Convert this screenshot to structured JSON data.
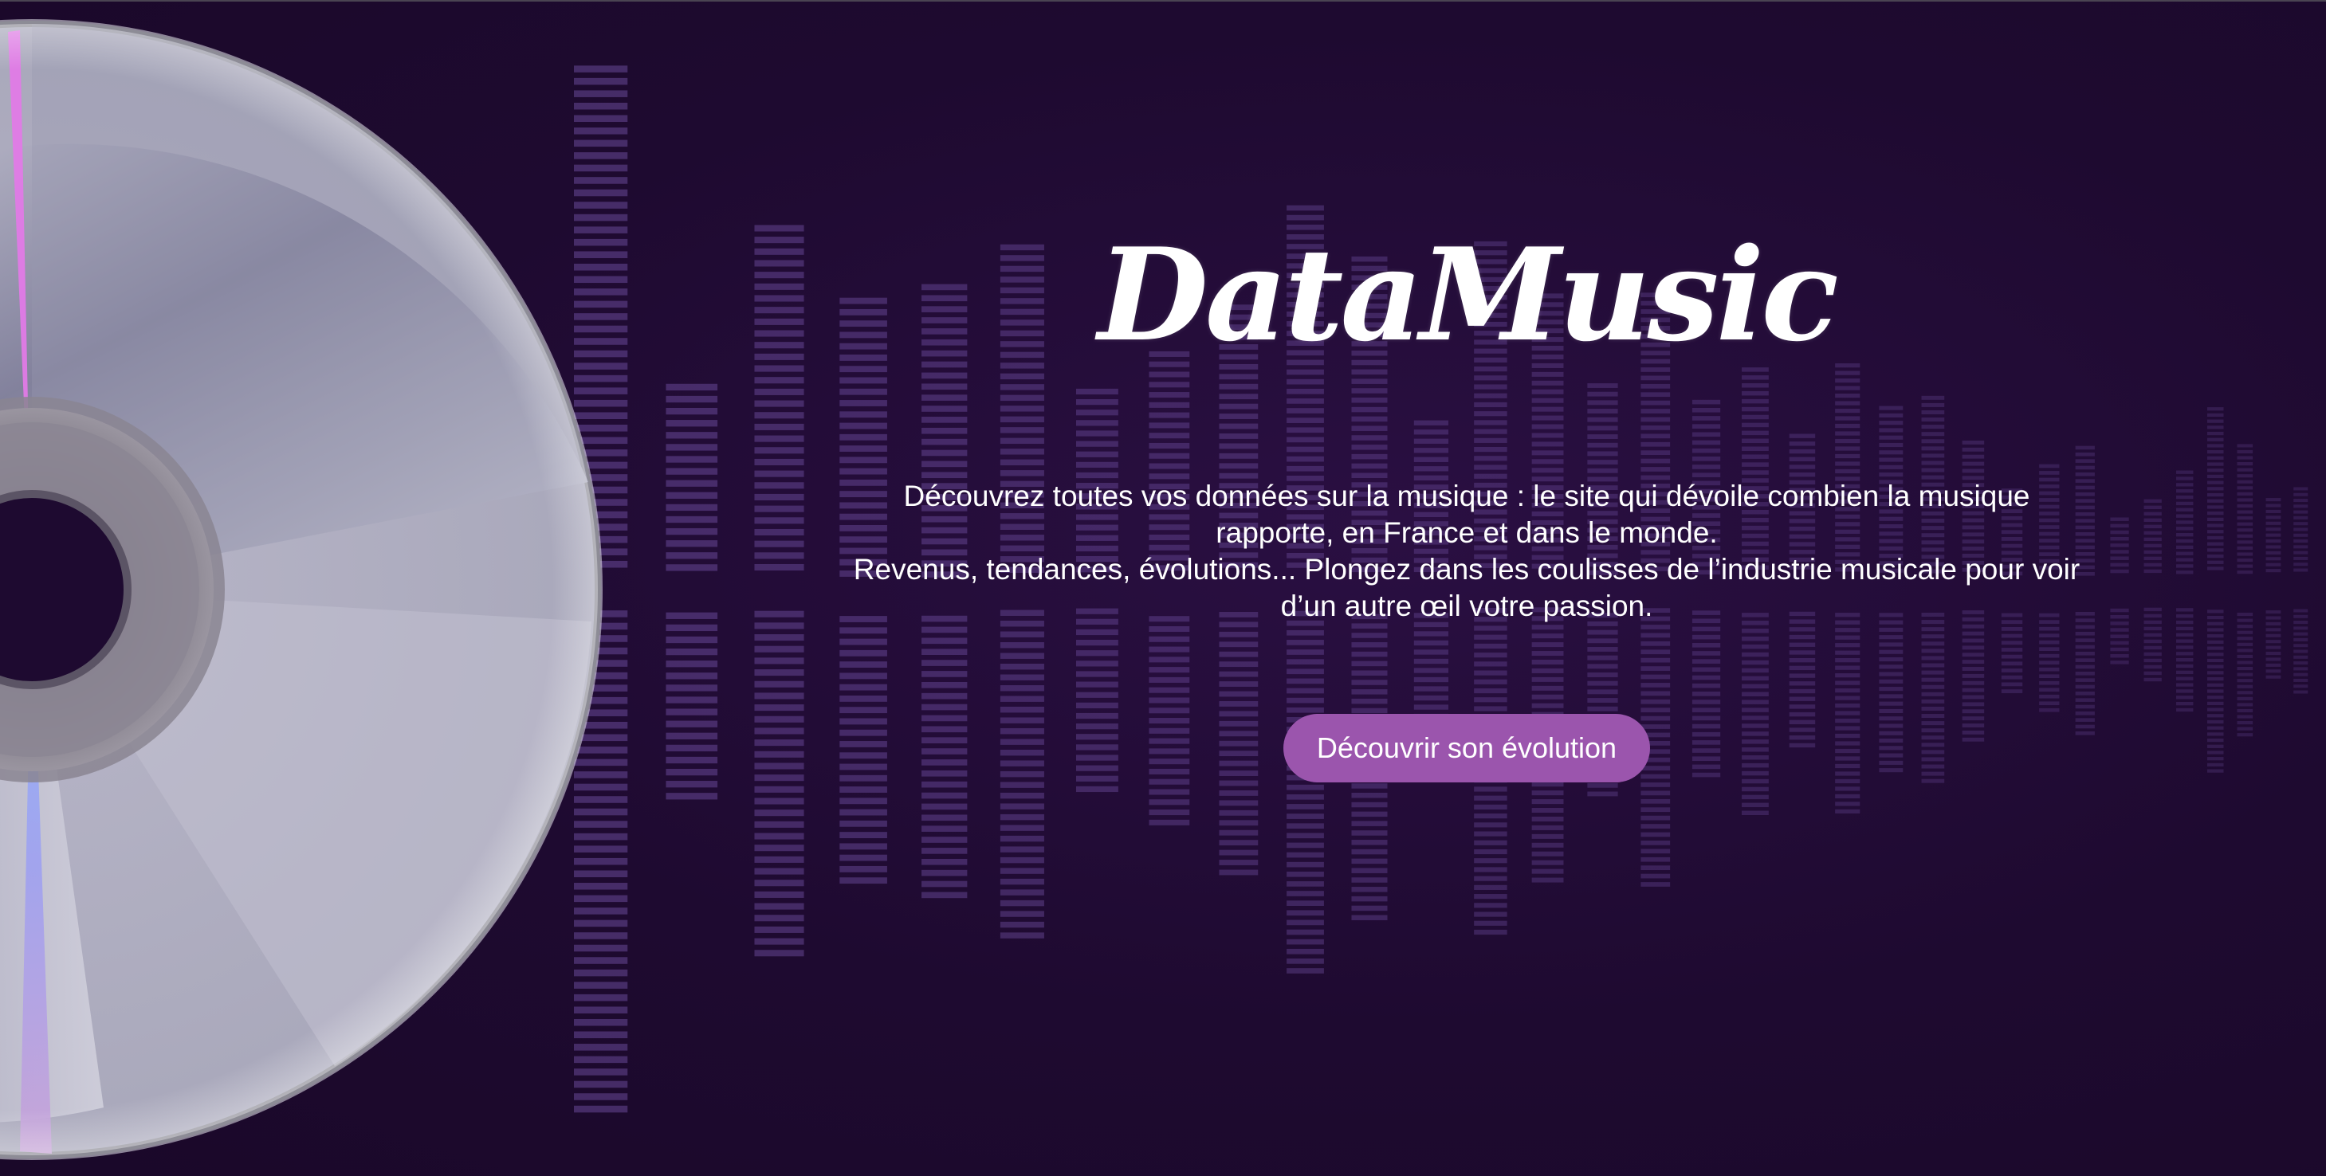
{
  "hero": {
    "title": "DataMusic",
    "intro_line_1": "Découvrez toutes vos données sur la musique : le site qui dévoile combien la musique rapporte, en France et dans le monde.",
    "intro_line_2": "Revenus, tendances, évolutions... Plongez dans les coulisses de l’industrie musicale pour voir d’un autre œil votre passion.",
    "cta_label": "Découvrir son évolution"
  },
  "colors": {
    "background": "#1e0a30",
    "accent": "#9b55ad",
    "equalizer": "#6a4a9a",
    "text": "#ffffff"
  },
  "decor": {
    "background_image": "equalizer-bars",
    "hero_image": "compact-disc"
  }
}
